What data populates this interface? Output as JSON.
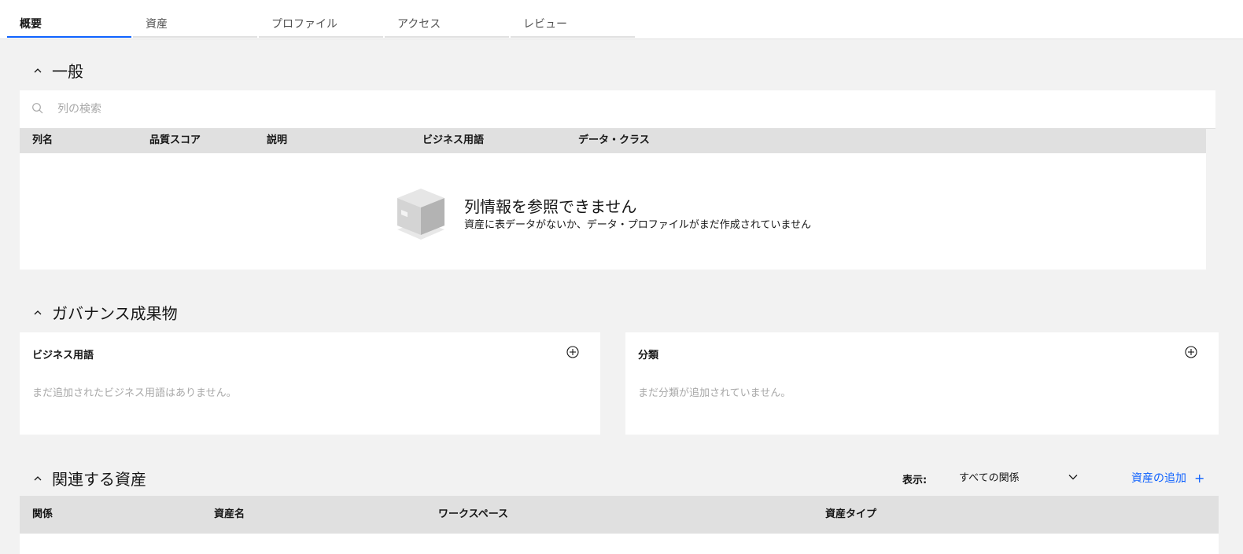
{
  "tabs": [
    {
      "label": "概要",
      "active": true
    },
    {
      "label": "資産"
    },
    {
      "label": "プロファイル"
    },
    {
      "label": "アクセス"
    },
    {
      "label": "レビュー"
    }
  ],
  "general": {
    "title": "一般",
    "search_placeholder": "列の検索",
    "columns": [
      "列名",
      "品質スコア",
      "説明",
      "ビジネス用語",
      "データ・クラス"
    ],
    "empty_title": "列情報を参照できません",
    "empty_subtitle": "資産に表データがないか、データ・プロファイルがまだ作成されていません"
  },
  "governance": {
    "title": "ガバナンス成果物",
    "business_terms": {
      "title": "ビジネス用語",
      "empty": "まだ追加されたビジネス用語はありません。"
    },
    "classification": {
      "title": "分類",
      "empty": "まだ分類が追加されていません。"
    }
  },
  "related": {
    "title": "関連する資産",
    "show_label": "表示:",
    "filter_value": "すべての関係",
    "add_label": "資産の追加",
    "add_icon": "+",
    "columns": [
      "関係",
      "資産名",
      "ワークスペース",
      "資産タイプ"
    ]
  },
  "colors": {
    "accent": "#0f62fe",
    "header_bg": "#e0e0e0",
    "page_bg": "#f2f2f2"
  }
}
